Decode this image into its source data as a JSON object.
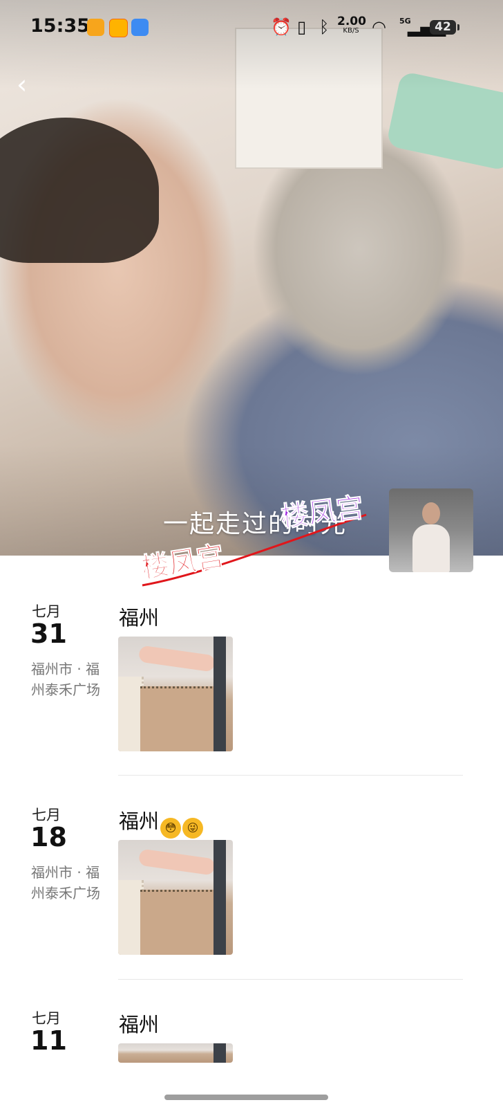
{
  "status_bar": {
    "time": "15:35",
    "net_speed_value": "2.00",
    "net_speed_unit": "KB/S",
    "signal_label": "5G",
    "battery": "42",
    "icons": [
      "alarm-icon",
      "vibrate-icon",
      "bluetooth-icon",
      "wifi-icon",
      "signal-icon"
    ]
  },
  "cover": {
    "caption": "一起走过的时光",
    "watermarks": [
      "楼凤宫",
      "楼凤宫"
    ]
  },
  "entries": [
    {
      "month": "七月",
      "day": "31",
      "location": "福州市 · 福州泰禾广场",
      "title": "福州",
      "emojis": []
    },
    {
      "month": "七月",
      "day": "18",
      "location": "福州市 · 福州泰禾广场",
      "title": "福州",
      "emojis": [
        "flushed-face",
        "winking-face-tongue"
      ]
    },
    {
      "month": "七月",
      "day": "11",
      "location": "",
      "title": "福州",
      "emojis": []
    }
  ],
  "colors": {
    "watermark_purple": "#9b22e0",
    "watermark_red": "#e0161b"
  }
}
